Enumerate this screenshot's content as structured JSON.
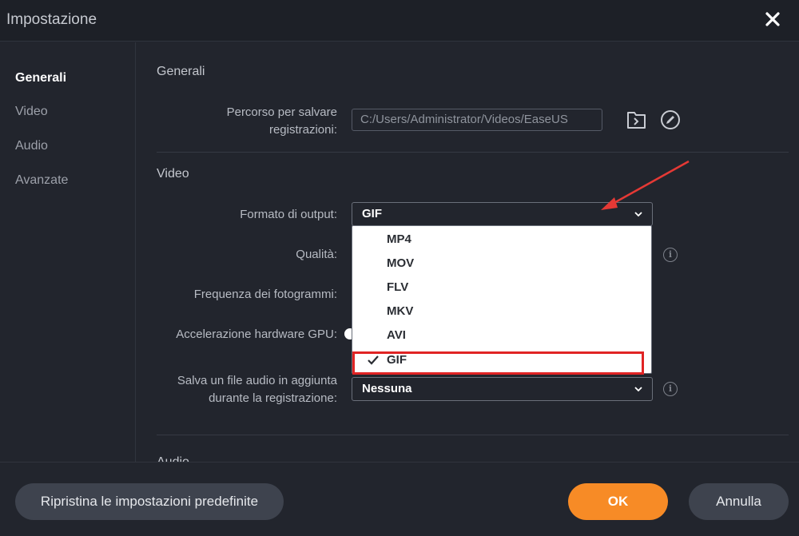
{
  "window": {
    "title": "Impostazione"
  },
  "sidebar": {
    "items": [
      {
        "label": "Generali",
        "active": true
      },
      {
        "label": "Video",
        "active": false
      },
      {
        "label": "Audio",
        "active": false
      },
      {
        "label": "Avanzate",
        "active": false
      }
    ]
  },
  "general": {
    "section_title": "Generali",
    "save_path_label_line1": "Percorso per salvare",
    "save_path_label_line2": "registrazioni:",
    "save_path_value": "C:/Users/Administrator/Videos/EaseUS"
  },
  "video": {
    "section_title": "Video",
    "output_format_label": "Formato di output:",
    "output_format_value": "GIF",
    "quality_label": "Qualità:",
    "framerate_label": "Frequenza dei fotogrammi:",
    "gpu_label": "Accelerazione hardware GPU:",
    "audio_extra_label_line1": "Salva un file audio in aggiunta",
    "audio_extra_label_line2": "durante la registrazione:",
    "audio_extra_value": "Nessuna"
  },
  "format_dropdown": {
    "options": [
      "MP4",
      "MOV",
      "FLV",
      "MKV",
      "AVI",
      "GIF"
    ],
    "selected": "GIF"
  },
  "audio_section_partial": "Audio",
  "footer": {
    "reset_label": "Ripristina le impostazioni predefinite",
    "ok_label": "OK",
    "cancel_label": "Annulla"
  },
  "colors": {
    "accent": "#f78b26",
    "background": "#22252d",
    "highlight_box": "#e02424",
    "annotation_arrow": "#e53935"
  }
}
